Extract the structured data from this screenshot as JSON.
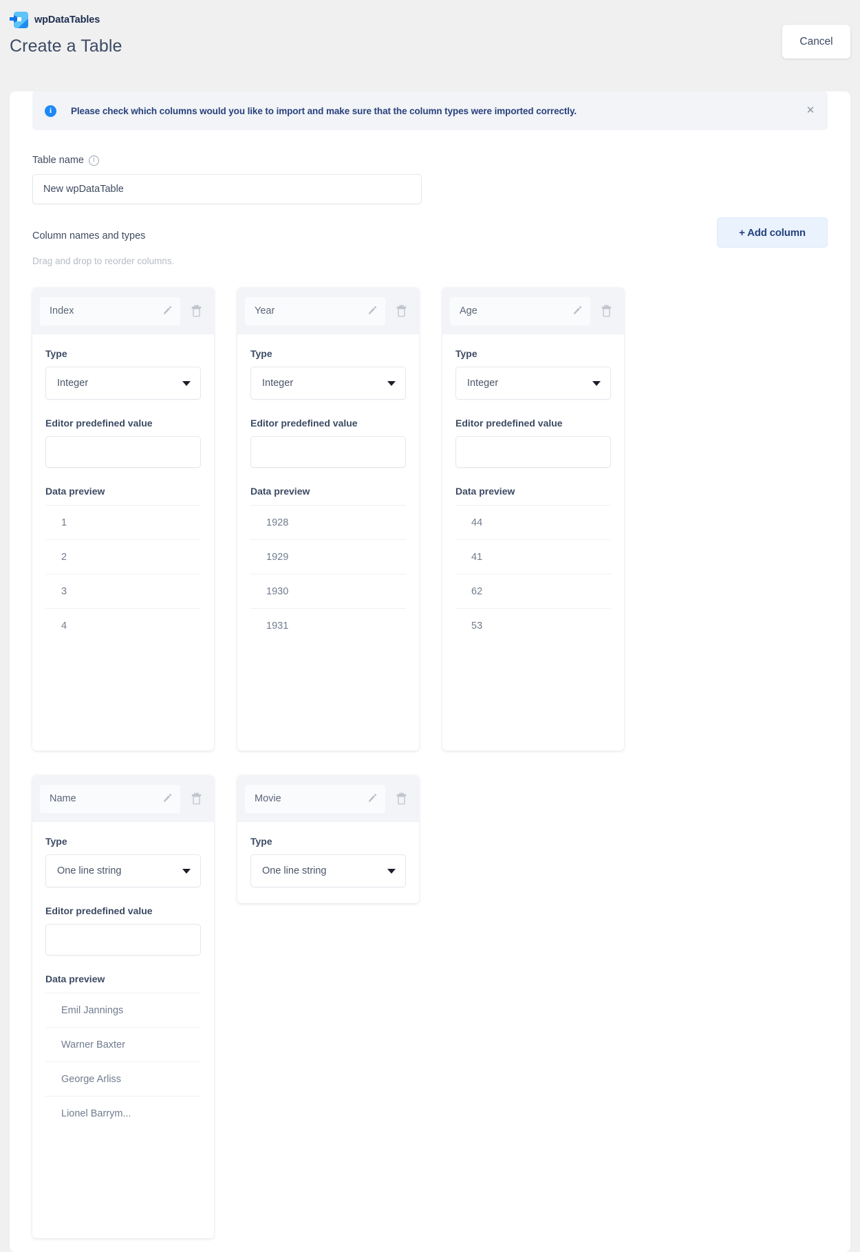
{
  "brand": {
    "name": "wpDataTables",
    "logo_icon": "wpdatatables-logo-icon"
  },
  "header": {
    "title": "Create a Table",
    "cancel_label": "Cancel"
  },
  "notice": {
    "icon": "info-icon",
    "text": "Please check which columns would you like to import and make sure that the column types were imported correctly.",
    "close_icon": "close-icon",
    "accent_color": "#1e88f7",
    "background_color": "#f2f4f7",
    "text_color": "#29417c"
  },
  "table_name": {
    "label": "Table name",
    "info_icon": "info-circle-icon",
    "value": "New wpDataTable",
    "placeholder": "Table name"
  },
  "columns_section": {
    "title": "Column names and types",
    "hint": "Drag and drop to reorder columns.",
    "add_button_label": "+ Add column",
    "add_button_color": "#eaf2fe"
  },
  "labels": {
    "type": "Type",
    "editor_predefined_value": "Editor predefined value",
    "data_preview": "Data preview",
    "edit_icon": "pencil-icon",
    "delete_icon": "trash-icon",
    "caret_icon": "chevron-down-icon"
  },
  "columns": [
    {
      "name": "Index",
      "type": "Integer",
      "editor_value": "",
      "preview": [
        "1",
        "2",
        "3",
        "4"
      ]
    },
    {
      "name": "Year",
      "type": "Integer",
      "editor_value": "",
      "preview": [
        "1928",
        "1929",
        "1930",
        "1931"
      ]
    },
    {
      "name": "Age",
      "type": "Integer",
      "editor_value": "",
      "preview": [
        "44",
        "41",
        "62",
        "53"
      ]
    },
    {
      "name": "Name",
      "type": "One line string",
      "editor_value": "",
      "preview": [
        "Emil Jannings",
        "Warner Baxter",
        "George Arliss",
        "Lionel Barrym..."
      ]
    },
    {
      "name": "Movie",
      "type": "One line string",
      "editor_value": "",
      "preview": []
    }
  ]
}
